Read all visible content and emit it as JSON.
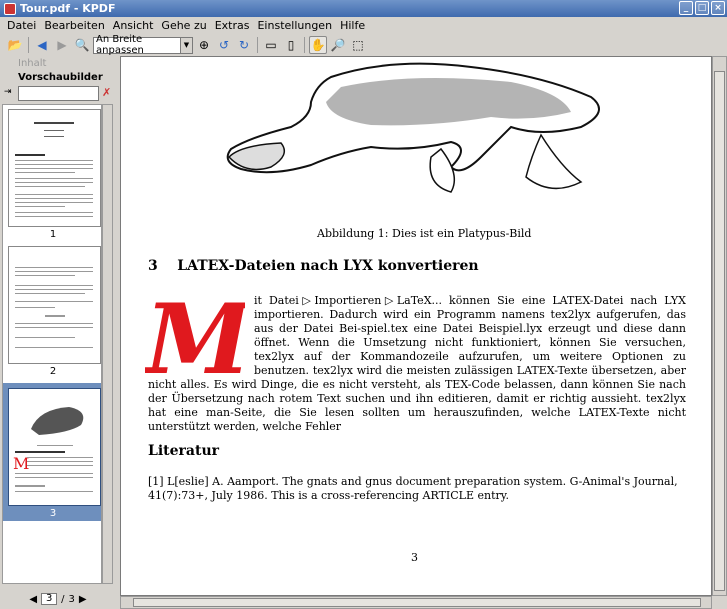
{
  "window": {
    "title": "Tour.pdf - KPDF"
  },
  "menu": [
    "Datei",
    "Bearbeiten",
    "Ansicht",
    "Gehe zu",
    "Extras",
    "Einstellungen",
    "Hilfe"
  ],
  "toolbar": {
    "zoom_value": "An Breite anpassen"
  },
  "sidebar": {
    "tab_contents": "Inhalt",
    "tab_thumbnails": "Vorschaubilder",
    "thumb_labels": [
      "1",
      "2",
      "3"
    ]
  },
  "pagenav": {
    "current": "3",
    "separator": "/",
    "total": "3"
  },
  "document": {
    "caption": "Abbildung 1: Dies ist ein Platypus-Bild",
    "section_number": "3",
    "section_title": "LATEX-Dateien nach LYX konvertieren",
    "dropcap_letter": "M",
    "paragraph": "it Datei▷Importieren▷LaTeX... können Sie eine LATEX-Datei nach LYX importieren. Dadurch wird ein Programm namens tex2lyx aufgerufen, das aus der Datei Bei-spiel.tex eine Datei Beispiel.lyx erzeugt und diese dann öffnet. Wenn die Umsetzung nicht funktioniert, können Sie versuchen, tex2lyx auf der Kommandozeile aufzurufen, um weitere Optionen zu benutzen. tex2lyx wird die meisten zulässigen LATEX-Texte übersetzen, aber nicht alles. Es wird Dinge, die es nicht versteht, als TEX-Code belassen, dann können Sie nach der Übersetzung nach rotem Text suchen und ihn editieren, damit er richtig aussieht. tex2lyx hat eine man-Seite, die Sie lesen sollten um herauszufinden, welche LATEX-Texte nicht unterstützt werden, welche Fehler",
    "literature_title": "Literatur",
    "reference": "[1] L[eslie] A. Aamport. The gnats and gnus document preparation system. G-Animal's Journal, 41(7):73+, July 1986. This is a cross-referencing ARTICLE entry.",
    "page_number": "3"
  },
  "colors": {
    "titlebar": "#4a73b3",
    "dropcap": "#e0191e",
    "selection": "#6e8fbd"
  }
}
